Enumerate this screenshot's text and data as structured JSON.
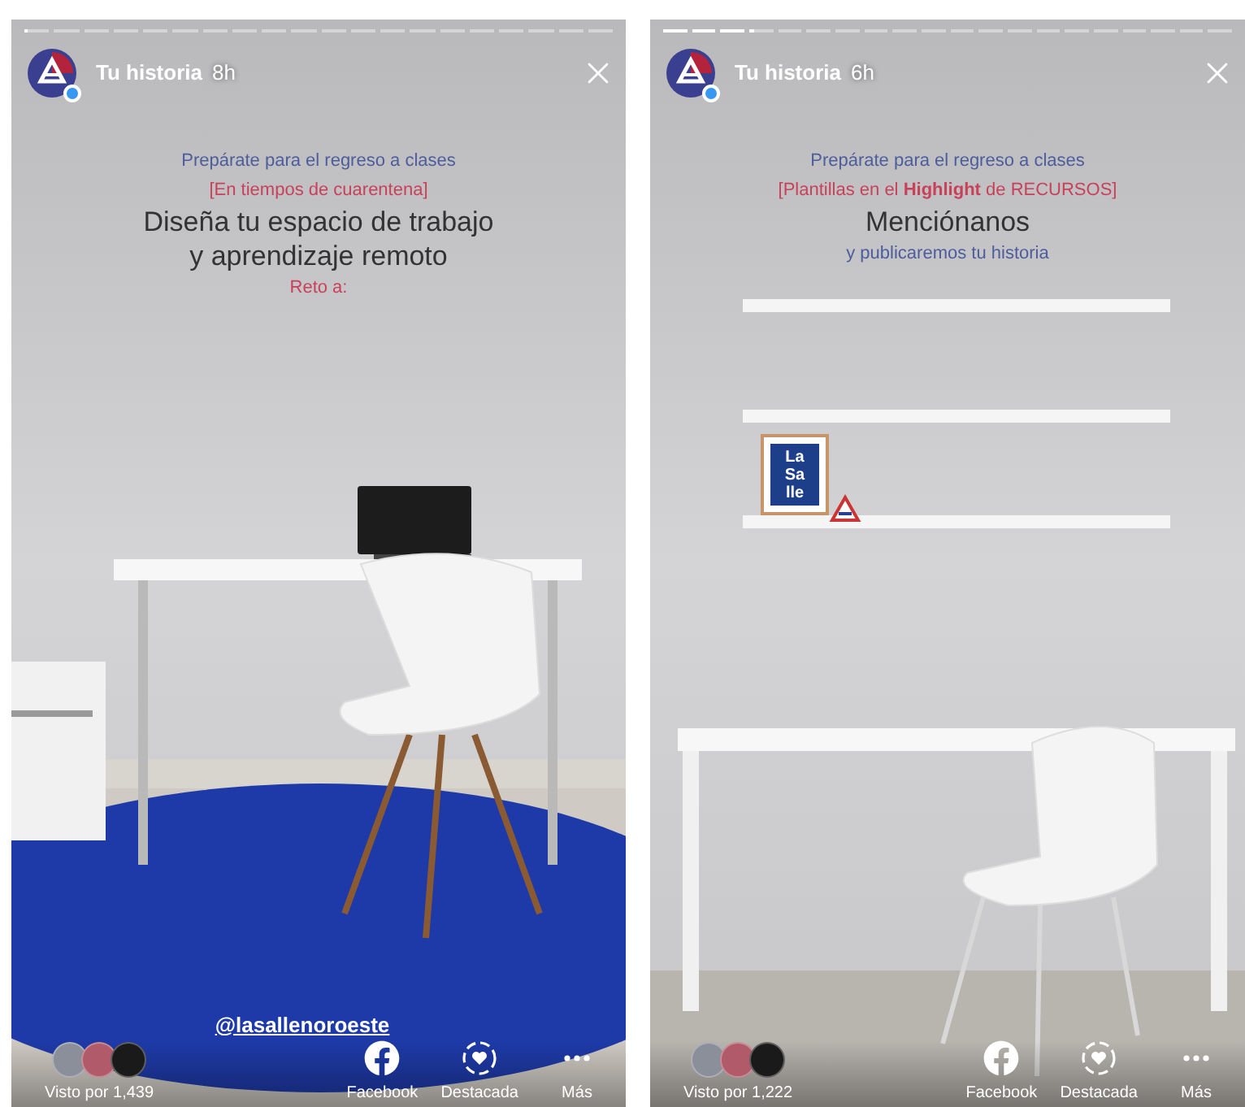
{
  "stories": [
    {
      "progress": [
        {
          "level": 0.1
        },
        {
          "level": 0
        },
        {
          "level": 0
        },
        {
          "level": 0
        },
        {
          "level": 0
        },
        {
          "level": 0
        },
        {
          "level": 0
        },
        {
          "level": 0
        },
        {
          "level": 0
        },
        {
          "level": 0
        },
        {
          "level": 0
        },
        {
          "level": 0
        },
        {
          "level": 0
        },
        {
          "level": 0
        },
        {
          "level": 0
        },
        {
          "level": 0
        },
        {
          "level": 0
        },
        {
          "level": 0
        },
        {
          "level": 0
        },
        {
          "level": 0
        }
      ],
      "account": "Tu historia",
      "age": "8h",
      "lines": [
        {
          "kind": "subtitle",
          "text": "Prepárate para el regreso a clases"
        },
        {
          "kind": "tag",
          "text": "[En tiempos de cuarentena]"
        },
        {
          "kind": "headline",
          "text": "Diseña tu espacio de trabajo"
        },
        {
          "kind": "headline",
          "text": "y aprendizaje remoto"
        },
        {
          "kind": "tag",
          "text": "Reto a:"
        }
      ],
      "kind": "desk_rug",
      "mention": "@lasallenoroeste",
      "viewers": "Visto por 1,439",
      "actions": [
        {
          "kind": "facebook",
          "label": "Facebook"
        },
        {
          "kind": "highlight",
          "label": "Destacada"
        },
        {
          "kind": "more",
          "label": "Más"
        }
      ]
    },
    {
      "progress": [
        {
          "level": 1
        },
        {
          "level": 1
        },
        {
          "level": 1
        },
        {
          "level": 0.2
        },
        {
          "level": 0
        },
        {
          "level": 0
        },
        {
          "level": 0
        },
        {
          "level": 0
        },
        {
          "level": 0
        },
        {
          "level": 0
        },
        {
          "level": 0
        },
        {
          "level": 0
        },
        {
          "level": 0
        },
        {
          "level": 0
        },
        {
          "level": 0
        },
        {
          "level": 0
        },
        {
          "level": 0
        },
        {
          "level": 0
        },
        {
          "level": 0
        },
        {
          "level": 0
        }
      ],
      "account": "Tu historia",
      "age": "6h",
      "lines": [
        {
          "kind": "subtitle",
          "text": "Prepárate para el regreso a clases"
        },
        {
          "kind": "tag",
          "text": "[Plantillas en el **Highlight** de RECURSOS]"
        },
        {
          "kind": "headline",
          "text": "Menciónanos"
        },
        {
          "kind": "subtitle",
          "text": "y publicaremos tu historia"
        }
      ],
      "kind": "shelves",
      "logo_text": [
        "La",
        "Sa",
        "lle"
      ],
      "viewers": "Visto por 1,222",
      "actions": [
        {
          "kind": "facebook",
          "label": "Facebook"
        },
        {
          "kind": "highlight",
          "label": "Destacada"
        },
        {
          "kind": "more",
          "label": "Más"
        }
      ]
    }
  ]
}
